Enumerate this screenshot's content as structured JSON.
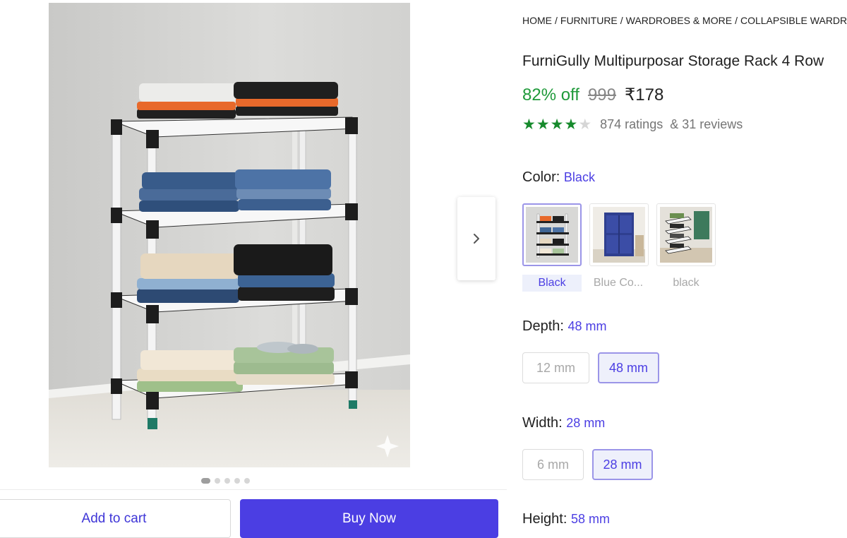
{
  "breadcrumb": [
    "HOME",
    "FURNITURE",
    "WARDROBES & MORE",
    "COLLAPSIBLE WARDROBES"
  ],
  "product": {
    "title": "FurniGully Multipurposar Storage Rack 4 Row",
    "discount": "82% off",
    "mrp": "999",
    "price": "₹178",
    "rating_stars": 4,
    "ratings_count": "874 ratings",
    "reviews_count": "& 31 reviews"
  },
  "color": {
    "label": "Color:",
    "value": "Black",
    "options": [
      {
        "name": "Black",
        "selected": true
      },
      {
        "name": "Blue Co...",
        "selected": false
      },
      {
        "name": "black",
        "selected": false
      }
    ]
  },
  "depth": {
    "label": "Depth:",
    "value": "48 mm",
    "options": [
      {
        "name": "12 mm",
        "selected": false
      },
      {
        "name": "48 mm",
        "selected": true
      }
    ]
  },
  "width": {
    "label": "Width:",
    "value": "28 mm",
    "options": [
      {
        "name": "6 mm",
        "selected": false
      },
      {
        "name": "28 mm",
        "selected": true
      }
    ]
  },
  "height": {
    "label": "Height:",
    "value": "58 mm"
  },
  "gallery": {
    "image_count": 5,
    "active_index": 0
  },
  "actions": {
    "add_to_cart": "Add to cart",
    "buy_now": "Buy Now"
  },
  "icons": {
    "next": "chevron-right-icon",
    "rating_star": "star-icon",
    "watermark": "sparkle-icon"
  },
  "colors": {
    "accent": "#4b3ee3",
    "discount_green": "#1f9a3a",
    "star_green": "#168a2c",
    "muted": "#a8a8a8"
  }
}
